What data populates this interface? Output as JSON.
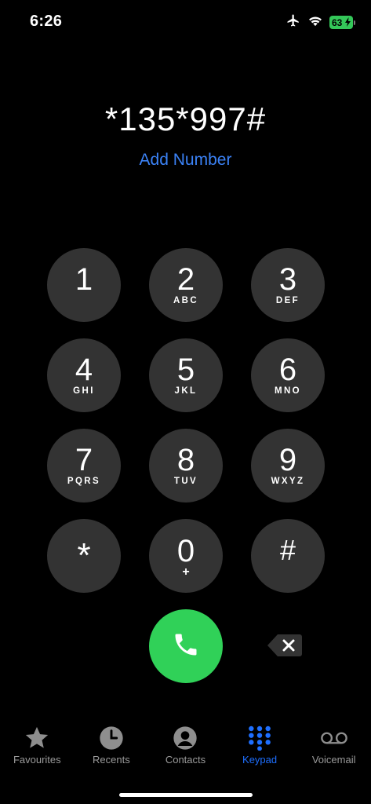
{
  "status_bar": {
    "time": "6:26",
    "battery_level": "63",
    "icons": [
      "airplane-icon",
      "wifi-icon",
      "battery-icon"
    ]
  },
  "dialer": {
    "number": "*135*997#",
    "add_number_label": "Add Number"
  },
  "keys": [
    {
      "digit": "1",
      "letters": ""
    },
    {
      "digit": "2",
      "letters": "ABC"
    },
    {
      "digit": "3",
      "letters": "DEF"
    },
    {
      "digit": "4",
      "letters": "GHI"
    },
    {
      "digit": "5",
      "letters": "JKL"
    },
    {
      "digit": "6",
      "letters": "MNO"
    },
    {
      "digit": "7",
      "letters": "PQRS"
    },
    {
      "digit": "8",
      "letters": "TUV"
    },
    {
      "digit": "9",
      "letters": "WXYZ"
    },
    {
      "digit": "*",
      "letters": ""
    },
    {
      "digit": "0",
      "letters": "+"
    },
    {
      "digit": "#",
      "letters": ""
    }
  ],
  "tabs": [
    {
      "label": "Favourites",
      "icon": "star-icon",
      "active": false
    },
    {
      "label": "Recents",
      "icon": "clock-icon",
      "active": false
    },
    {
      "label": "Contacts",
      "icon": "person-icon",
      "active": false
    },
    {
      "label": "Keypad",
      "icon": "keypad-icon",
      "active": true
    },
    {
      "label": "Voicemail",
      "icon": "voicemail-icon",
      "active": false
    }
  ],
  "colors": {
    "background": "#000000",
    "key_background": "#333333",
    "call_green": "#30d158",
    "accent_blue": "#1e6fff",
    "link_blue": "#3b82f6",
    "inactive_gray": "#9a9a9a"
  }
}
